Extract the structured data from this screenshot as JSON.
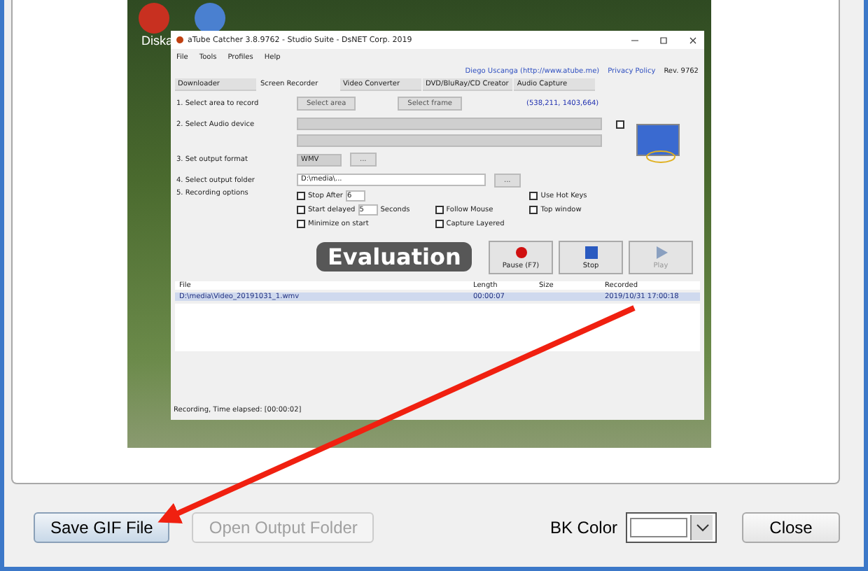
{
  "preview": {
    "desktop_icon_label": "Diska",
    "app": {
      "title": "aTube Catcher 3.8.9762 - Studio Suite - DsNET Corp. 2019",
      "menu": [
        "File",
        "Tools",
        "Profiles",
        "Help"
      ],
      "links": [
        "Diego Uscanga (http://www.atube.me)",
        "Privacy Policy"
      ],
      "revision": "Rev. 9762",
      "tabs": [
        {
          "label": "Downloader",
          "selected": false
        },
        {
          "label": "Screen Recorder",
          "selected": true
        },
        {
          "label": "Video Converter",
          "selected": false
        },
        {
          "label": "DVD/BluRay/CD Creator",
          "selected": false
        },
        {
          "label": "Audio Capture",
          "selected": false
        }
      ],
      "step1": {
        "label": "1. Select area to record",
        "buttons": [
          "Select area",
          "Select frame"
        ],
        "coords": "(538,211, 1403,664)"
      },
      "step2": {
        "label": "2. Select Audio device",
        "checked": false
      },
      "step3": {
        "label": "3. Set output format",
        "format": "WMV",
        "more": "..."
      },
      "step4": {
        "label": "4. Select output folder",
        "value": "D:\\media\\...",
        "browse": "..."
      },
      "step5": {
        "label": "5. Recording options",
        "seconds": "Seconds",
        "options": [
          {
            "label": "Stop After",
            "checked": false,
            "value": "6"
          },
          {
            "label": "Start delayed",
            "checked": false,
            "value": "5"
          },
          {
            "label": "Minimize on start",
            "checked": false
          },
          {
            "label": "Follow Mouse",
            "checked": false
          },
          {
            "label": "Capture Layered",
            "checked": false
          },
          {
            "label": "Use Hot Keys",
            "checked": false
          },
          {
            "label": "Top window",
            "checked": false
          }
        ]
      },
      "controls": [
        {
          "kind": "record",
          "label": "Pause (F7)",
          "disabled": false
        },
        {
          "kind": "stop",
          "label": "Stop",
          "disabled": false
        },
        {
          "kind": "play",
          "label": "Play",
          "disabled": true
        }
      ],
      "table": {
        "columns": [
          "File",
          "Length",
          "Size",
          "Recorded"
        ],
        "rows": [
          {
            "cells": [
              "D:\\media\\Video_20191031_1.wmv",
              "00:00:07",
              "",
              "2019/10/31 17:00:18"
            ],
            "selected": true
          }
        ]
      },
      "status": "Recording, Time elapsed: [00:00:02]"
    },
    "watermark": "Evaluation"
  },
  "buttons": [
    {
      "label": "Save GIF File",
      "disabled": false
    },
    {
      "label": "Open Output Folder",
      "disabled": true
    }
  ],
  "bk_color": {
    "label": "BK Color",
    "color": "#ffffff"
  },
  "close": "Close"
}
